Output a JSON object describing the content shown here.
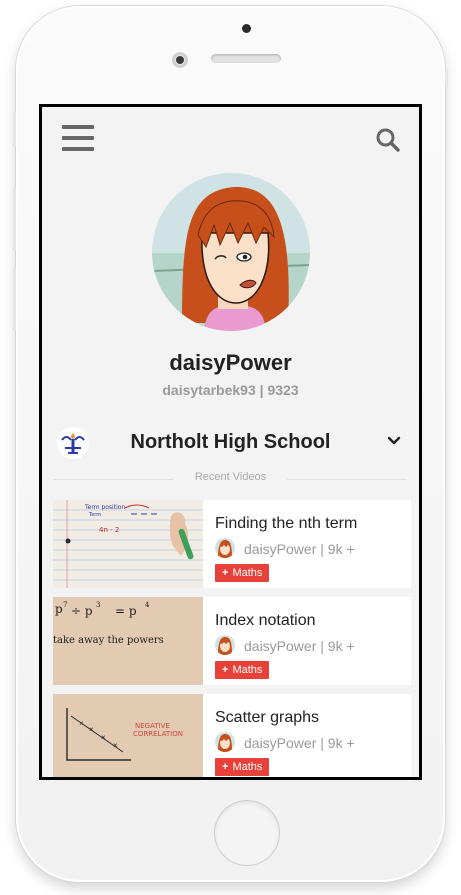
{
  "profile": {
    "username": "daisyPower",
    "handle": "daisytarbek93",
    "separator": "|",
    "points": "9323"
  },
  "school": {
    "name": "Northolt High School"
  },
  "section": {
    "label": "Recent Videos"
  },
  "videos": [
    {
      "title": "Finding the nth term",
      "author": "daisyPower",
      "views": "| 9k +",
      "tag": "Maths"
    },
    {
      "title": "Index notation",
      "author": "daisyPower",
      "views": "| 9k +",
      "tag": "Maths"
    },
    {
      "title": "Scatter graphs",
      "author": "daisyPower",
      "views": "| 9k +",
      "tag": "Maths"
    }
  ],
  "thumbnails": {
    "nth": {
      "line1": "Term position",
      "line2": "Term",
      "line3": "4n - 2"
    },
    "index": {
      "line1": "p",
      "line2": "÷ p",
      "line3": "= p",
      "line4": "take away the powers"
    },
    "scatter": {
      "line1": "NEGATIVE",
      "line2": "CORRELATION"
    }
  },
  "colors": {
    "accent": "#e8413a",
    "screen_bg": "#f3f3f3",
    "text": "#222222",
    "muted": "#9a9a9a"
  },
  "icons": {
    "menu": "hamburger-icon",
    "search": "search-icon",
    "chevron": "chevron-down-icon",
    "plus": "plus-icon"
  }
}
